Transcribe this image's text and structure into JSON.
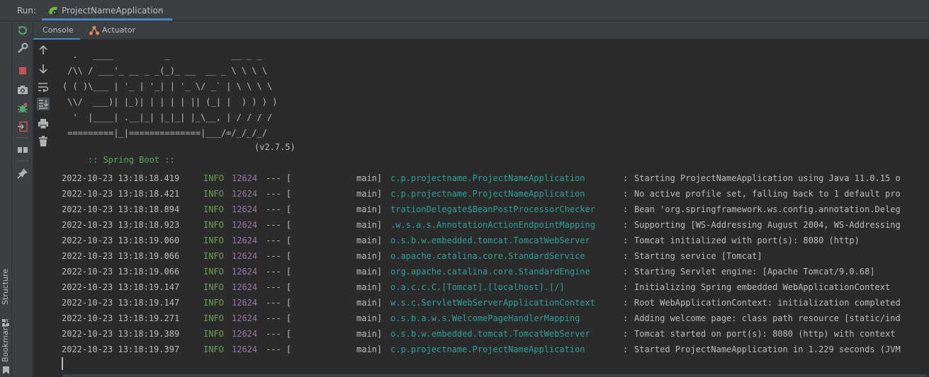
{
  "run_bar": {
    "label": "Run:",
    "tab": {
      "label": "ProjectNameApplication",
      "icon": "spring-run-icon",
      "close_icon": "close-icon",
      "close_glyph": "×"
    }
  },
  "left_strip": {
    "structure_label": "Structure",
    "bookmarks_label": "Bookmarks"
  },
  "run_actions": [
    {
      "name": "rerun-icon",
      "tooltip": "Rerun"
    },
    {
      "name": "wrench-icon",
      "tooltip": "Settings"
    },
    {
      "name": "stop-icon",
      "tooltip": "Stop"
    },
    {
      "name": "camera-icon",
      "tooltip": "Dump Threads"
    },
    {
      "name": "debug-bug-icon",
      "tooltip": "Debug"
    },
    {
      "name": "exit-icon",
      "tooltip": "Exit"
    },
    {
      "name": "layout-icon",
      "tooltip": "Layout"
    },
    {
      "name": "pin-icon",
      "tooltip": "Pin"
    }
  ],
  "console_tabs": {
    "console_label": "Console",
    "actuator_label": "Actuator"
  },
  "console_tools": [
    {
      "name": "arrow-up-icon",
      "glyph": "↑",
      "active": false
    },
    {
      "name": "arrow-down-icon",
      "glyph": "↓",
      "active": false
    },
    {
      "name": "soft-wrap-icon",
      "glyph": "",
      "active": false
    },
    {
      "name": "scroll-to-end-icon",
      "glyph": "",
      "active": true
    },
    {
      "name": "print-icon",
      "glyph": "",
      "active": false
    },
    {
      "name": "trash-icon",
      "glyph": "",
      "active": false
    }
  ],
  "banner": [
    "  .   ____          _            __ _ _",
    " /\\\\ / ___'_ __ _ _(_)_ __  __ _ \\ \\ \\ \\",
    "( ( )\\___ | '_ | '_| | '_ \\/ _` | \\ \\ \\ \\",
    " \\\\/  ___)| |_)| | | | | || (_| |  ) ) ) )",
    "  '  |____| .__|_| |_|_| |_\\__, | / / / /",
    " =========|_|==============|___/=/_/_/_/"
  ],
  "boot": {
    "label": ":: Spring Boot ::",
    "version": "(v2.7.5)"
  },
  "log_lines": [
    {
      "ts": "2022-10-23 13:18:18.419",
      "level": "INFO",
      "pid": "12624",
      "sep": "--- [",
      "thread": "main]",
      "logger": "c.p.projectname.ProjectNameApplication",
      "msg": "Starting ProjectNameApplication using Java 11.0.15 o"
    },
    {
      "ts": "2022-10-23 13:18:18.421",
      "level": "INFO",
      "pid": "12624",
      "sep": "--- [",
      "thread": "main]",
      "logger": "c.p.projectname.ProjectNameApplication",
      "msg": "No active profile set, falling back to 1 default pro"
    },
    {
      "ts": "2022-10-23 13:18:18.894",
      "level": "INFO",
      "pid": "12624",
      "sep": "--- [",
      "thread": "main]",
      "logger": "trationDelegate$BeanPostProcessorChecker",
      "msg": "Bean 'org.springframework.ws.config.annotation.Deleg"
    },
    {
      "ts": "2022-10-23 13:18:18.923",
      "level": "INFO",
      "pid": "12624",
      "sep": "--- [",
      "thread": "main]",
      "logger": ".w.s.a.s.AnnotationActionEndpointMapping",
      "msg": "Supporting [WS-Addressing August 2004, WS-Addressing"
    },
    {
      "ts": "2022-10-23 13:18:19.060",
      "level": "INFO",
      "pid": "12624",
      "sep": "--- [",
      "thread": "main]",
      "logger": "o.s.b.w.embedded.tomcat.TomcatWebServer",
      "msg": "Tomcat initialized with port(s): 8080 (http)"
    },
    {
      "ts": "2022-10-23 13:18:19.066",
      "level": "INFO",
      "pid": "12624",
      "sep": "--- [",
      "thread": "main]",
      "logger": "o.apache.catalina.core.StandardService",
      "msg": "Starting service [Tomcat]"
    },
    {
      "ts": "2022-10-23 13:18:19.066",
      "level": "INFO",
      "pid": "12624",
      "sep": "--- [",
      "thread": "main]",
      "logger": "org.apache.catalina.core.StandardEngine",
      "msg": "Starting Servlet engine: [Apache Tomcat/9.0.68]"
    },
    {
      "ts": "2022-10-23 13:18:19.147",
      "level": "INFO",
      "pid": "12624",
      "sep": "--- [",
      "thread": "main]",
      "logger": "o.a.c.c.C.[Tomcat].[localhost].[/]",
      "msg": "Initializing Spring embedded WebApplicationContext"
    },
    {
      "ts": "2022-10-23 13:18:19.147",
      "level": "INFO",
      "pid": "12624",
      "sep": "--- [",
      "thread": "main]",
      "logger": "w.s.c.ServletWebServerApplicationContext",
      "msg": "Root WebApplicationContext: initialization completed"
    },
    {
      "ts": "2022-10-23 13:18:19.271",
      "level": "INFO",
      "pid": "12624",
      "sep": "--- [",
      "thread": "main]",
      "logger": "o.s.b.a.w.s.WelcomePageHandlerMapping",
      "msg": "Adding welcome page: class path resource [static/ind"
    },
    {
      "ts": "2022-10-23 13:18:19.389",
      "level": "INFO",
      "pid": "12624",
      "sep": "--- [",
      "thread": "main]",
      "logger": "o.s.b.w.embedded.tomcat.TomcatWebServer",
      "msg": "Tomcat started on port(s): 8080 (http) with context"
    },
    {
      "ts": "2022-10-23 13:18:19.397",
      "level": "INFO",
      "pid": "12624",
      "sep": "--- [",
      "thread": "main]",
      "logger": "c.p.projectname.ProjectNameApplication",
      "msg": "Started ProjectNameApplication in 1.229 seconds (JVM"
    }
  ],
  "colors": {
    "accent": "#4a88c7",
    "level_info": "#6a9f51",
    "pid": "#9876aa",
    "logger": "#2aa198",
    "spring_green": "#56a95b",
    "stop_red": "#c75450"
  }
}
